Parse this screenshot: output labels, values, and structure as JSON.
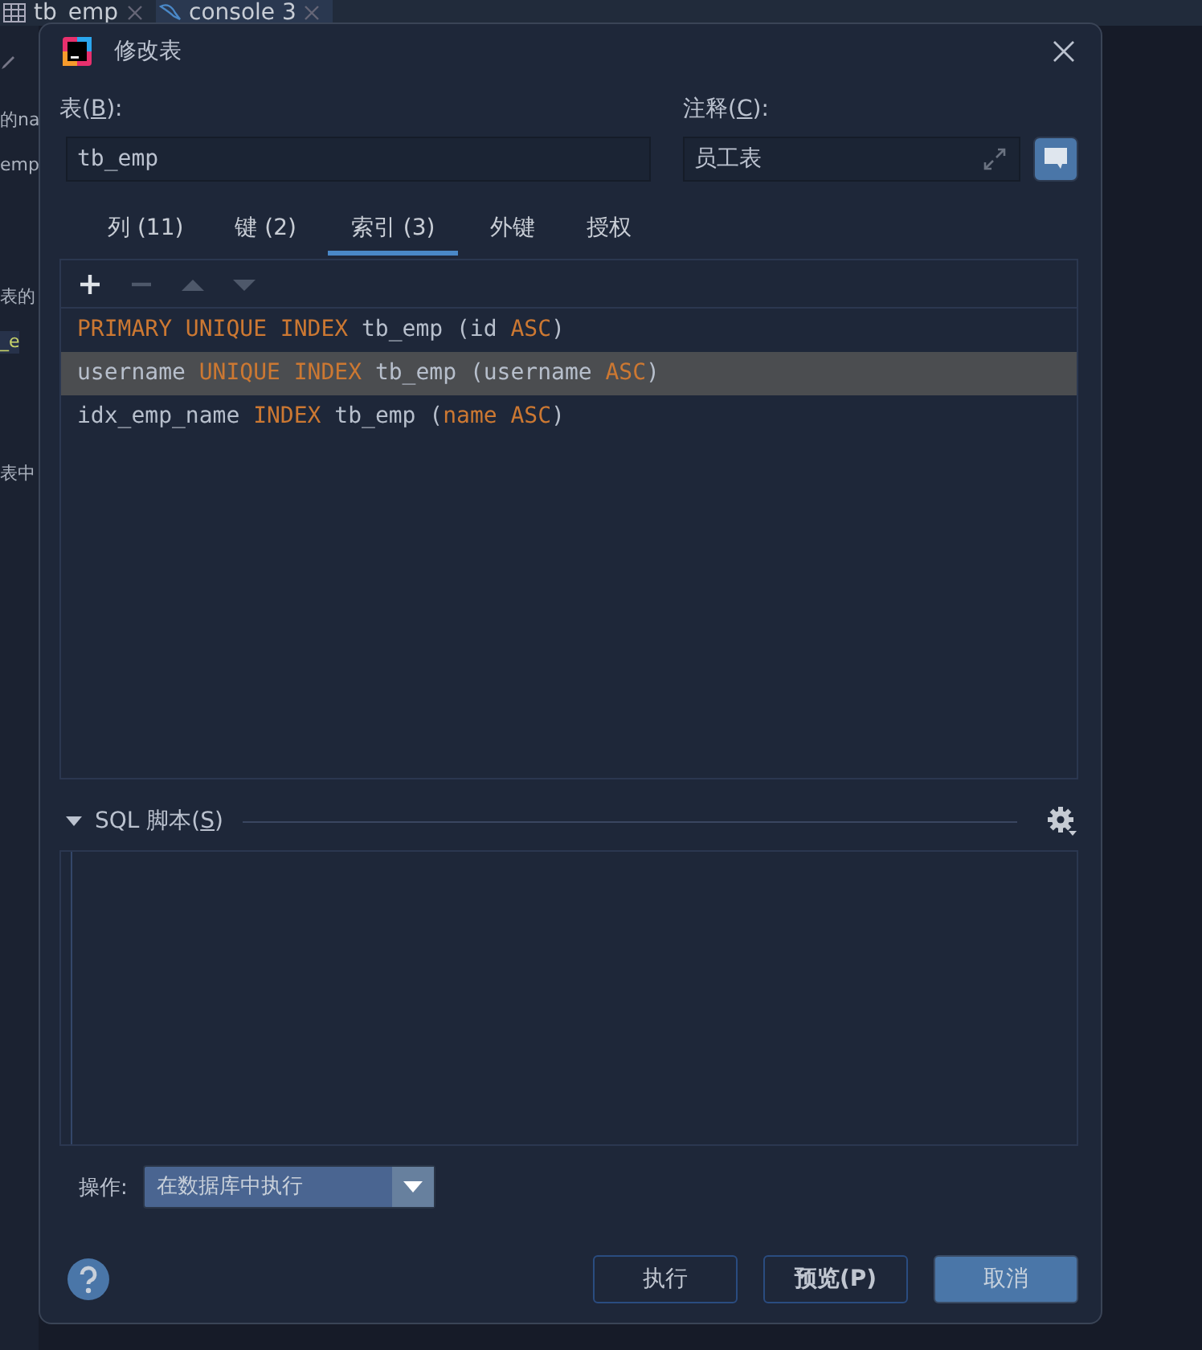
{
  "ide_tabs": [
    {
      "kind": "table",
      "label": "tb_emp",
      "selected": false
    },
    {
      "kind": "console",
      "label": "console 3",
      "selected": true
    }
  ],
  "ide_fragments": [
    {
      "text": "的na",
      "highlighted": false
    },
    {
      "text": "emp",
      "highlighted": false
    },
    {
      "text": "表的",
      "highlighted": false
    },
    {
      "text": "_e",
      "highlighted": true
    },
    {
      "text": "表中",
      "highlighted": false
    }
  ],
  "dialog": {
    "title": "修改表",
    "table_label": {
      "before": "表(",
      "mnemonic": "B",
      "after": "):"
    },
    "table_name": "tb_emp",
    "comment_label": {
      "before": "注释(",
      "mnemonic": "C",
      "after": "):"
    },
    "comment": "员工表",
    "tabs": [
      {
        "label": "列 (11)",
        "selected": false
      },
      {
        "label": "键 (2)",
        "selected": false
      },
      {
        "label": "索引 (3)",
        "selected": true
      },
      {
        "label": "外键",
        "selected": false
      },
      {
        "label": "授权",
        "selected": false
      }
    ],
    "toolbar": [
      {
        "kind": "add",
        "disabled": false
      },
      {
        "kind": "remove",
        "disabled": true
      },
      {
        "kind": "up",
        "disabled": true
      },
      {
        "kind": "down",
        "disabled": true
      }
    ],
    "indexes": [
      {
        "selected": false,
        "parts": [
          {
            "text": "PRIMARY UNIQUE INDEX",
            "kind": "keyword"
          },
          {
            "text": " tb_emp (id ",
            "kind": "plain"
          },
          {
            "text": "ASC",
            "kind": "keyword"
          },
          {
            "text": ")",
            "kind": "plain"
          }
        ]
      },
      {
        "selected": true,
        "parts": [
          {
            "text": "username ",
            "kind": "plain"
          },
          {
            "text": "UNIQUE INDEX",
            "kind": "keyword"
          },
          {
            "text": " tb_emp (username ",
            "kind": "plain"
          },
          {
            "text": "ASC",
            "kind": "keyword"
          },
          {
            "text": ")",
            "kind": "plain"
          }
        ]
      },
      {
        "selected": false,
        "parts": [
          {
            "text": "idx_emp_name ",
            "kind": "plain"
          },
          {
            "text": "INDEX",
            "kind": "keyword"
          },
          {
            "text": " tb_emp (",
            "kind": "plain"
          },
          {
            "text": "name ASC",
            "kind": "keyword"
          },
          {
            "text": ")",
            "kind": "plain"
          }
        ]
      }
    ],
    "sql_section": {
      "label": {
        "before": "SQL 脚本(",
        "mnemonic": "S",
        "after": ")"
      },
      "expanded": true
    },
    "operation_label": "操作:",
    "operation": "在数据库中执行",
    "buttons": [
      {
        "label": "执行",
        "kind": "default"
      },
      {
        "label": "预览(P)",
        "kind": "bold"
      },
      {
        "label": "取消",
        "kind": "primary"
      }
    ]
  }
}
